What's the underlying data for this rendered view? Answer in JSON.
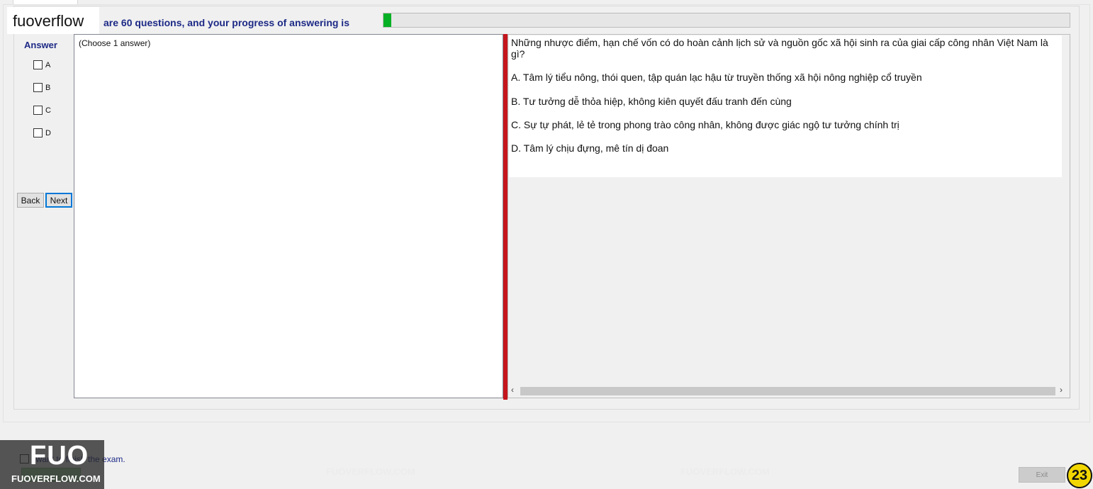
{
  "header": {
    "brand_label": "fuoverflow",
    "progress_text": "are 60 questions, and your progress of answering is",
    "progress_fraction": 0.011
  },
  "answer_panel": {
    "heading": "Answer",
    "options": [
      {
        "letter": "A",
        "checked": false
      },
      {
        "letter": "B",
        "checked": false
      },
      {
        "letter": "C",
        "checked": false
      },
      {
        "letter": "D",
        "checked": false
      }
    ],
    "back_label": "Back",
    "next_label": "Next"
  },
  "answer_area": {
    "hint": "(Choose 1 answer)"
  },
  "question": {
    "text": "Những nhược điểm, hạn chế vốn có do hoàn cảnh lịch sử và nguồn gốc xã hội sinh ra của giai cấp công nhân Việt Nam là gì?",
    "options": [
      "A.  Tâm lý tiểu nông, thói quen, tập quán lạc hậu từ truyền thống xã hội nông nghiệp cổ truyền",
      "B.  Tư tưởng dễ thỏa hiệp, không kiên quyết đấu tranh đến cùng",
      "C.  Sự tự phát, lẻ tẻ trong phong trào công nhân, không được giác ngộ tư tưởng chính trị",
      "D.  Tâm lý chịu đựng, mê tín dị đoan"
    ]
  },
  "footer": {
    "finish_label": "I want to finish the exam.",
    "finish_checked": false,
    "exit_label": "Exit",
    "logo_big": "FUO",
    "logo_small": "FUOVERFLOW.COM",
    "page_badge": "23"
  },
  "watermark": "FUOVERFLOW.COM",
  "colors": {
    "heading_blue": "#1d2a86",
    "progress_green": "#06b025",
    "splitter_red": "#c4161c",
    "badge_yellow": "#f2d600"
  }
}
